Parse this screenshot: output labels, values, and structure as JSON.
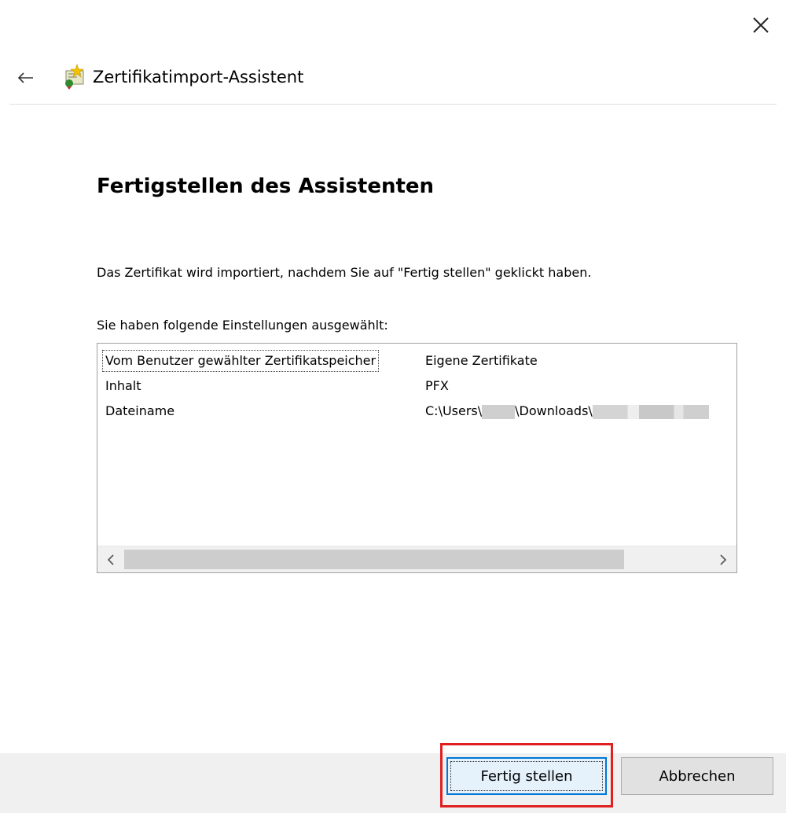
{
  "window": {
    "close_icon": "close-icon"
  },
  "header": {
    "back_icon": "back-arrow-icon",
    "wizard_icon": "certificate-wizard-icon",
    "title": "Zertifikatimport-Assistent"
  },
  "main": {
    "title": "Fertigstellen des Assistenten",
    "description": "Das Zertifikat wird importiert, nachdem Sie auf \"Fertig stellen\" geklickt haben.",
    "settings_label": "Sie haben folgende Einstellungen ausgewählt:",
    "settings": [
      {
        "key": "Vom Benutzer gewählter Zertifikatspeicher",
        "value": "Eigene Zertifikate"
      },
      {
        "key": "Inhalt",
        "value": "PFX"
      },
      {
        "key": "Dateiname",
        "value_prefix": "C:\\Users\\",
        "value_mid": "\\Downloads\\"
      }
    ],
    "scroll_left_icon": "chevron-left-icon",
    "scroll_right_icon": "chevron-right-icon"
  },
  "footer": {
    "finish_label": "Fertig stellen",
    "cancel_label": "Abbrechen"
  },
  "colors": {
    "accent": "#0078d7",
    "highlight": "#e02020",
    "footer_bg": "#f0f0f0"
  }
}
